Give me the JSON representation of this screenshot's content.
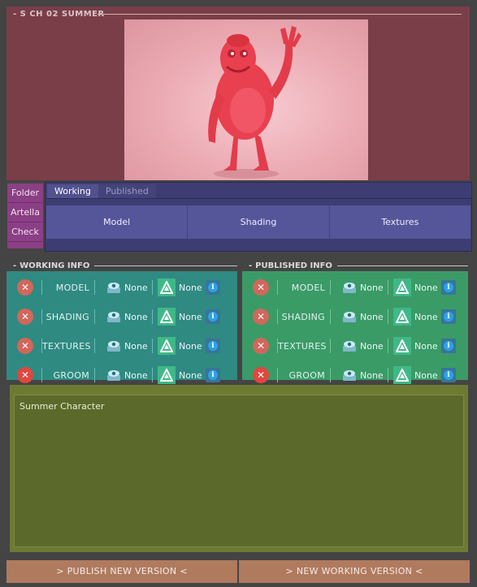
{
  "asset": {
    "title": "S CH 02 SUMMER",
    "preview_image": "red cartoon character waving"
  },
  "side_tabs": [
    "Folder",
    "Artella",
    "Check"
  ],
  "tabs": [
    {
      "label": "Working",
      "active": true
    },
    {
      "label": "Published",
      "active": false
    }
  ],
  "categories": [
    "Model",
    "Shading",
    "Textures"
  ],
  "working_info": {
    "title": "WORKING INFO",
    "rows": [
      {
        "label": "MODEL",
        "eye_value": "None",
        "artella_value": "None"
      },
      {
        "label": "SHADING",
        "eye_value": "None",
        "artella_value": "None"
      },
      {
        "label": "TEXTURES",
        "eye_value": "None",
        "artella_value": "None"
      },
      {
        "label": "GROOM",
        "eye_value": "None",
        "artella_value": "None"
      }
    ]
  },
  "published_info": {
    "title": "PUBLISHED INFO",
    "rows": [
      {
        "label": "MODEL",
        "eye_value": "None",
        "artella_value": "None"
      },
      {
        "label": "SHADING",
        "eye_value": "None",
        "artella_value": "None"
      },
      {
        "label": "TEXTURES",
        "eye_value": "None",
        "artella_value": "None"
      },
      {
        "label": "GROOM",
        "eye_value": "None",
        "artella_value": "None"
      }
    ]
  },
  "notes": {
    "text": "Summer Character"
  },
  "footer": {
    "publish_label": "> PUBLISH NEW VERSION <",
    "working_label": "> NEW WORKING VERSION <"
  },
  "colors": {
    "asset_panel": "#7a3e48",
    "side_tabs": "#8b3f84",
    "tabs_panel": "#3d3d73",
    "working_panel": "#2f8a82",
    "published_panel": "#3a9b67",
    "notes_panel": "#6d7a33",
    "footer_buttons": "#b07a5e",
    "x_button": "#d2675b",
    "info_icon": "#2ba2e6"
  },
  "icons": [
    "close-icon",
    "eye-icon",
    "artella-icon",
    "info-icon"
  ]
}
